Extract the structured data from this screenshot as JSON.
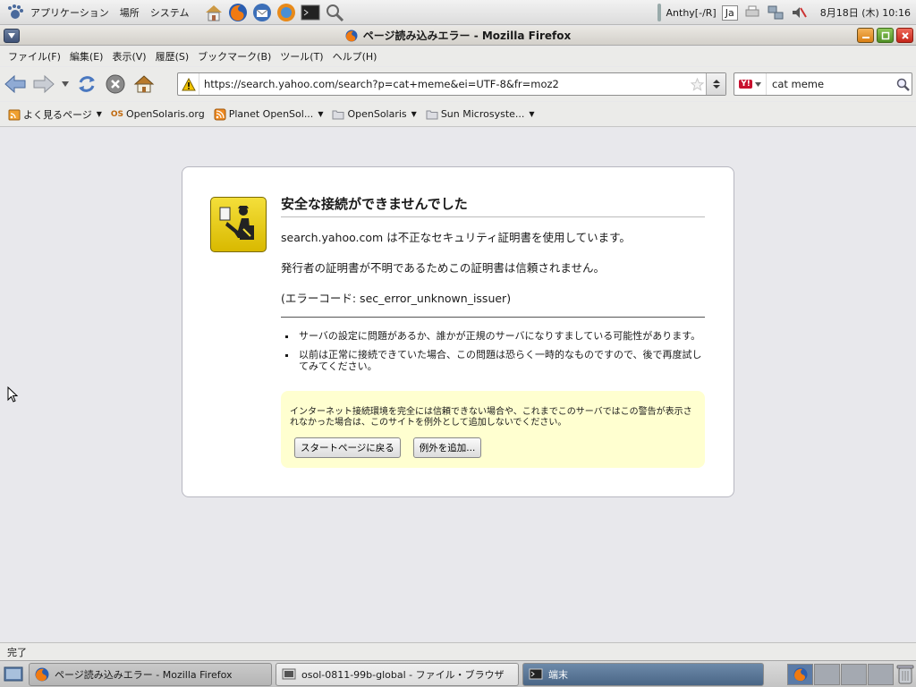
{
  "panel": {
    "menus": [
      "アプリケーション",
      "場所",
      "システム"
    ],
    "ime": "Anthy[-/R]",
    "ime_mode": "Ja",
    "clock": "8月18日 (木) 10:16"
  },
  "window": {
    "title": "ページ読み込みエラー - Mozilla Firefox"
  },
  "menubar": [
    "ファイル(F)",
    "編集(E)",
    "表示(V)",
    "履歴(S)",
    "ブックマーク(B)",
    "ツール(T)",
    "ヘルプ(H)"
  ],
  "nav": {
    "url": "https://search.yahoo.com/search?p=cat+meme&ei=UTF-8&fr=moz2",
    "search_value": "cat meme",
    "search_engine_logo": "Y!"
  },
  "bookmarks": [
    {
      "label": "よく見るページ",
      "icon": "rss-folder-icon",
      "has_menu": true
    },
    {
      "label": "OpenSolaris.org",
      "icon": "opensolaris-icon",
      "has_menu": false,
      "icon_text": "OS"
    },
    {
      "label": "Planet OpenSol...",
      "icon": "rss-icon",
      "has_menu": true
    },
    {
      "label": "OpenSolaris",
      "icon": "folder-icon",
      "has_menu": true
    },
    {
      "label": "Sun Microsyste...",
      "icon": "folder-icon",
      "has_menu": true
    }
  ],
  "error": {
    "title": "安全な接続ができませんでした",
    "line1": "search.yahoo.com は不正なセキュリティ証明書を使用しています。",
    "line2": "発行者の証明書が不明であるためこの証明書は信頼されません。",
    "line3": "(エラーコード: sec_error_unknown_issuer)",
    "bullets": [
      "サーバの設定に問題があるか、誰かが正規のサーバになりすましている可能性があります。",
      "以前は正常に接続できていた場合、この問題は恐らく一時的なものですので、後で再度試してみてください。"
    ],
    "warning": "インターネット接続環境を完全には信頼できない場合や、これまでこのサーバではこの警告が表示されなかった場合は、このサイトを例外として追加しないでください。",
    "btn_start": "スタートページに戻る",
    "btn_exception": "例外を追加..."
  },
  "status": "完了",
  "taskbar": {
    "tasks": [
      "ページ読み込みエラー - Mozilla Firefox",
      "osol-0811-99b-global - ファイル・ブラウザ",
      "端末"
    ]
  }
}
